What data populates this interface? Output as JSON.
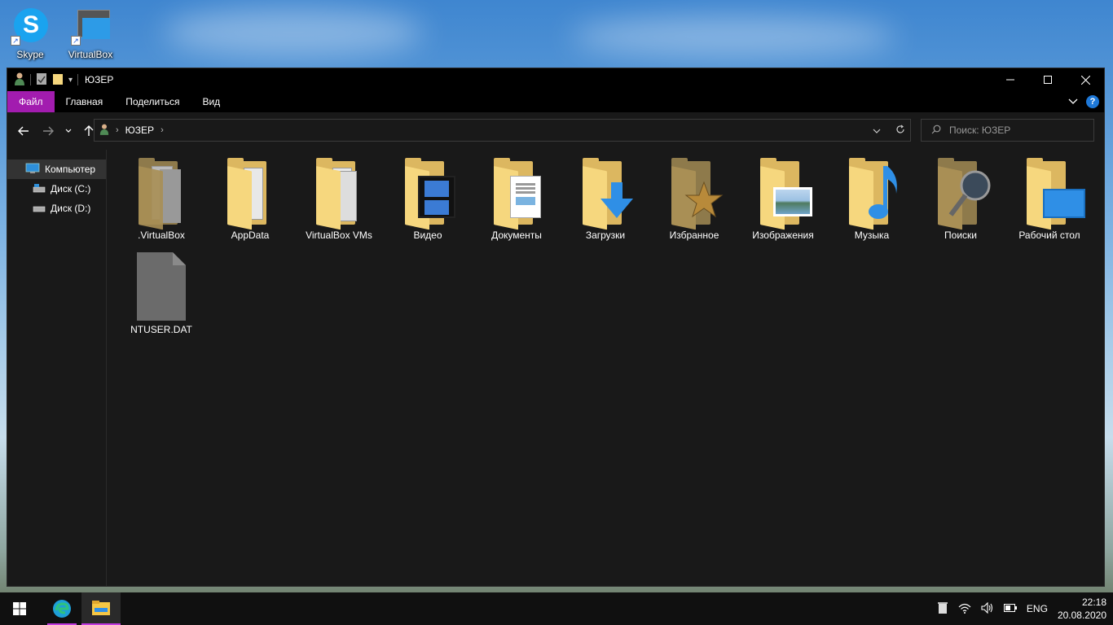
{
  "desktop": {
    "icons": [
      {
        "label": "Skype"
      },
      {
        "label": "VirtualBox"
      }
    ]
  },
  "window": {
    "title": "ЮЗЕР",
    "ribbon_tabs": [
      "Файл",
      "Главная",
      "Поделиться",
      "Вид"
    ],
    "address": {
      "crumb": "ЮЗЕР"
    },
    "search_placeholder": "Поиск: ЮЗЕР",
    "sidebar": [
      {
        "label": "Компьютер",
        "icon": "computer-icon"
      },
      {
        "label": "Диск (C:)",
        "icon": "drive-icon"
      },
      {
        "label": "Диск (D:)",
        "icon": "drive-icon"
      }
    ],
    "items": [
      {
        "name": ".VirtualBox",
        "icon": "folder-icon"
      },
      {
        "name": "AppData",
        "icon": "folder-icon"
      },
      {
        "name": "VirtualBox VMs",
        "icon": "folder-icon"
      },
      {
        "name": "Видео",
        "icon": "videos-folder-icon"
      },
      {
        "name": "Документы",
        "icon": "documents-folder-icon"
      },
      {
        "name": "Загрузки",
        "icon": "downloads-folder-icon"
      },
      {
        "name": "Избранное",
        "icon": "favorites-folder-icon"
      },
      {
        "name": "Изображения",
        "icon": "pictures-folder-icon"
      },
      {
        "name": "Музыка",
        "icon": "music-folder-icon"
      },
      {
        "name": "Поиски",
        "icon": "searches-folder-icon"
      },
      {
        "name": "Рабочий стол",
        "icon": "desktop-folder-icon"
      },
      {
        "name": "NTUSER.DAT",
        "icon": "file-icon"
      }
    ]
  },
  "taskbar": {
    "language": "ENG",
    "time": "22:18",
    "date": "20.08.2020"
  },
  "colors": {
    "accent": "#a21caf",
    "folder": "#f6d77e",
    "background": "#191919"
  }
}
